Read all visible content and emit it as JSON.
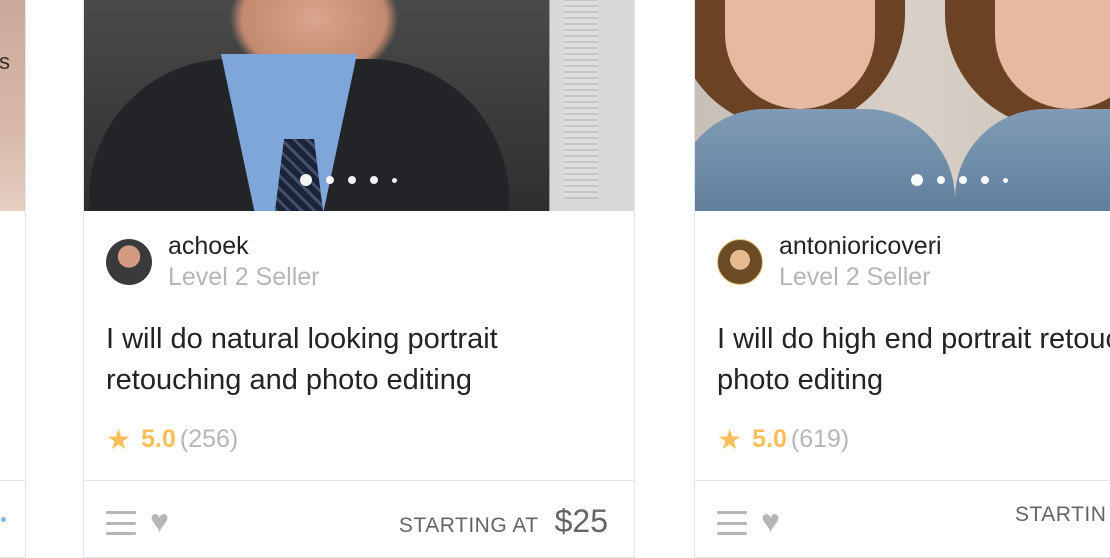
{
  "left_partial_card": {
    "thumb_text": "s"
  },
  "gigs": [
    {
      "seller": {
        "name": "achoek",
        "level": "Level 2 Seller"
      },
      "title": "I will do natural looking portrait retouching and photo editing",
      "rating": {
        "value": "5.0",
        "count": "(256)"
      },
      "price": {
        "label": "STARTING AT",
        "amount": "$25"
      }
    },
    {
      "seller": {
        "name": "antonioricoveri",
        "level": "Level 2 Seller"
      },
      "title": "I will do high end portrait retouching, photo editing",
      "rating": {
        "value": "5.0",
        "count": "(619)"
      },
      "price": {
        "label": "STARTIN",
        "amount": ""
      }
    }
  ],
  "icons": {
    "star": "star-icon",
    "menu": "menu-icon",
    "heart": "heart-icon"
  },
  "colors": {
    "star": "#ffbe5b",
    "muted_text": "#b5b6ba",
    "price_text": "#62646a",
    "border": "#e4e5e7"
  }
}
